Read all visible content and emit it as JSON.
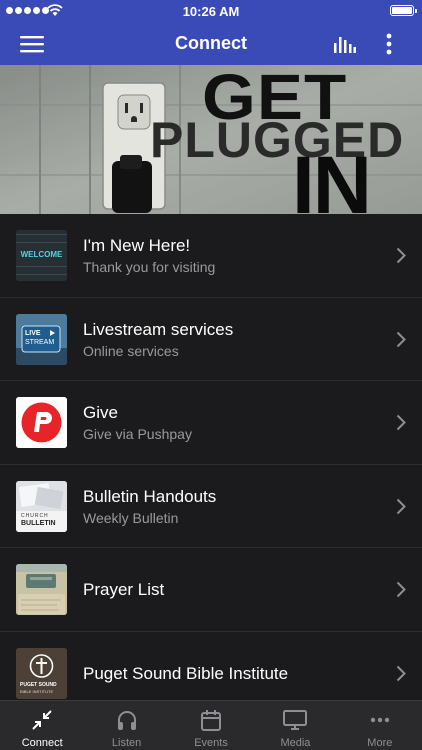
{
  "status_bar": {
    "time": "10:26 AM"
  },
  "navbar": {
    "title": "Connect"
  },
  "banner": {
    "line1": "GET",
    "line2": "PLUGGED",
    "line3": "IN"
  },
  "list": [
    {
      "title": "I'm New Here!",
      "subtitle": "Thank you for visiting",
      "thumb_text": "WELCOME"
    },
    {
      "title": "Livestream services",
      "subtitle": "Online services",
      "thumb_text_1": "LIVE",
      "thumb_text_2": "STREAM"
    },
    {
      "title": "Give",
      "subtitle": "Give via Pushpay"
    },
    {
      "title": "Bulletin Handouts",
      "subtitle": "Weekly Bulletin",
      "thumb_text_1": "CHURCH",
      "thumb_text_2": "BULLETIN"
    },
    {
      "title": "Prayer List"
    },
    {
      "title": "Puget Sound Bible Institute",
      "thumb_text_1": "PUGET SOUND",
      "thumb_text_2": "BIBLE INSTITUTE"
    }
  ],
  "tabs": [
    {
      "label": "Connect",
      "icon": "connect-icon",
      "active": true
    },
    {
      "label": "Listen",
      "icon": "headphones-icon"
    },
    {
      "label": "Events",
      "icon": "calendar-icon"
    },
    {
      "label": "Media",
      "icon": "monitor-icon"
    },
    {
      "label": "More",
      "icon": "more-dots-icon"
    }
  ],
  "colors": {
    "accent": "#3a4bb8",
    "background": "#1b1b1d",
    "tabbar": "#2a2a2c",
    "give_red": "#e8232a"
  }
}
